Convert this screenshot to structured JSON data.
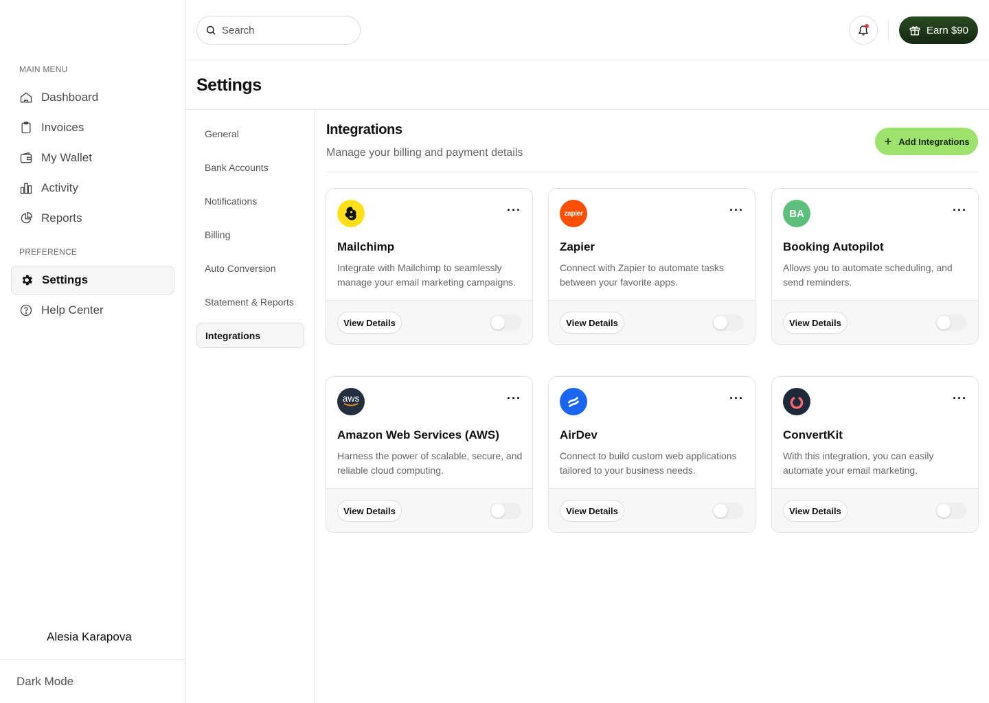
{
  "sidebar": {
    "main_menu_label": "MAIN MENU",
    "main_items": [
      {
        "label": "Dashboard",
        "icon": "home-icon"
      },
      {
        "label": "Invoices",
        "icon": "clipboard-icon"
      },
      {
        "label": "My Wallet",
        "icon": "wallet-icon"
      },
      {
        "label": "Activity",
        "icon": "bar-chart-icon"
      },
      {
        "label": "Reports",
        "icon": "pie-chart-icon"
      }
    ],
    "preference_label": "PREFERENCE",
    "pref_items": [
      {
        "label": "Settings",
        "icon": "gear-icon",
        "active": true
      },
      {
        "label": "Help Center",
        "icon": "help-icon"
      }
    ],
    "user_name": "Alesia Karapova",
    "dark_mode_label": "Dark Mode"
  },
  "topbar": {
    "search_placeholder": "Search",
    "earn_label": "Earn $90",
    "earn_color": "#1d3317"
  },
  "page": {
    "title": "Settings"
  },
  "settings_nav": {
    "items": [
      {
        "label": "General"
      },
      {
        "label": "Bank Accounts"
      },
      {
        "label": "Notifications"
      },
      {
        "label": "Billing"
      },
      {
        "label": "Auto Conversion"
      },
      {
        "label": "Statement & Reports"
      },
      {
        "label": "Integrations",
        "active": true
      }
    ]
  },
  "integrations": {
    "title": "Integrations",
    "subtitle": "Manage your billing and payment details",
    "add_label": "Add Integrations",
    "add_color": "#9ee26e",
    "view_details_label": "View Details",
    "cards": [
      {
        "name": "Mailchimp",
        "description": "Integrate with Mailchimp to seamlessly manage your email marketing campaigns.",
        "logo": "mailchimp-logo",
        "enabled": false
      },
      {
        "name": "Zapier",
        "description": "Connect with Zapier to automate tasks between your favorite apps.",
        "logo": "zapier-logo",
        "logo_text": "zapier",
        "enabled": false
      },
      {
        "name": "Booking Autopilot",
        "description": "Allows you to automate scheduling, and send reminders.",
        "logo": "ba-logo",
        "logo_text": "BA",
        "enabled": false
      },
      {
        "name": "Amazon Web Services (AWS)",
        "description": "Harness the power of scalable, secure, and reliable cloud computing.",
        "logo": "aws-logo",
        "logo_text": "aws",
        "enabled": false
      },
      {
        "name": "AirDev",
        "description": "Connect to build custom web applications tailored to your business needs.",
        "logo": "airdev-logo",
        "enabled": false
      },
      {
        "name": "ConvertKit",
        "description": "With this integration, you can easily automate your email marketing.",
        "logo": "convertkit-logo",
        "enabled": false
      }
    ]
  }
}
